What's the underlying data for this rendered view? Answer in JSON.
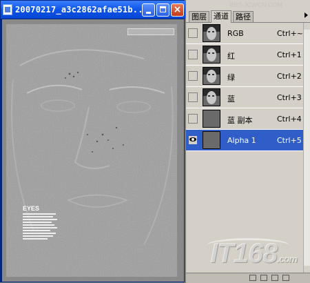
{
  "document_window": {
    "title": "20070217_a3c2862afae51b...",
    "buttons": {
      "minimize": "minimize",
      "maximize": "maximize",
      "close": "×"
    },
    "image_caption_title": "EYES"
  },
  "panel": {
    "watermark": "BBS.JCWCN.COM",
    "tabs": [
      "图层",
      "通道",
      "路径"
    ],
    "active_tab": "通道",
    "channels": [
      {
        "name": "RGB",
        "shortcut": "Ctrl+~",
        "visible": false,
        "thumb": "face"
      },
      {
        "name": "红",
        "shortcut": "Ctrl+1",
        "visible": false,
        "thumb": "face"
      },
      {
        "name": "绿",
        "shortcut": "Ctrl+2",
        "visible": false,
        "thumb": "face"
      },
      {
        "name": "蓝",
        "shortcut": "Ctrl+3",
        "visible": false,
        "thumb": "face"
      },
      {
        "name": "蓝 副本",
        "shortcut": "Ctrl+4",
        "visible": false,
        "thumb": "plain"
      },
      {
        "name": "Alpha 1",
        "shortcut": "Ctrl+5",
        "visible": true,
        "thumb": "plain",
        "selected": true
      }
    ]
  },
  "watermark": {
    "logo": "IT168",
    "suffix": ".com"
  },
  "colors": {
    "selection": "#2f5ec8",
    "titlebar": "#0a52e6",
    "panel_bg": "#d4d0c8"
  }
}
